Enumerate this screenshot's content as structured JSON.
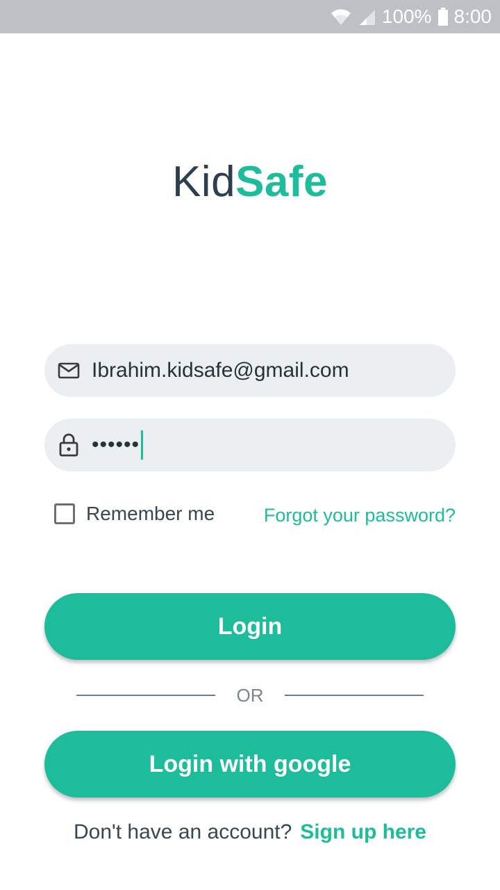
{
  "status_bar": {
    "battery": "100%",
    "time": "8:00",
    "icons": [
      "wifi-icon",
      "signal-icon",
      "battery-icon"
    ]
  },
  "logo": {
    "part1": "Kid",
    "part2": "Safe"
  },
  "form": {
    "email_value": "Ibrahim.kidsafe@gmail.com",
    "password_value": "••••••",
    "email_icon": "mail-icon",
    "password_icon": "lock-icon",
    "remember_label": "Remember me",
    "forgot_label": "Forgot your password?",
    "login_label": "Login",
    "or_label": "OR",
    "google_label": "Login with google"
  },
  "signup": {
    "question": "Don't have an account?",
    "link": "Sign up here"
  },
  "colors": {
    "accent": "#1dbd9b",
    "dark_text": "#2d3e50",
    "field_bg": "#eceff1",
    "status_bar_bg": "#bdc1c5"
  }
}
